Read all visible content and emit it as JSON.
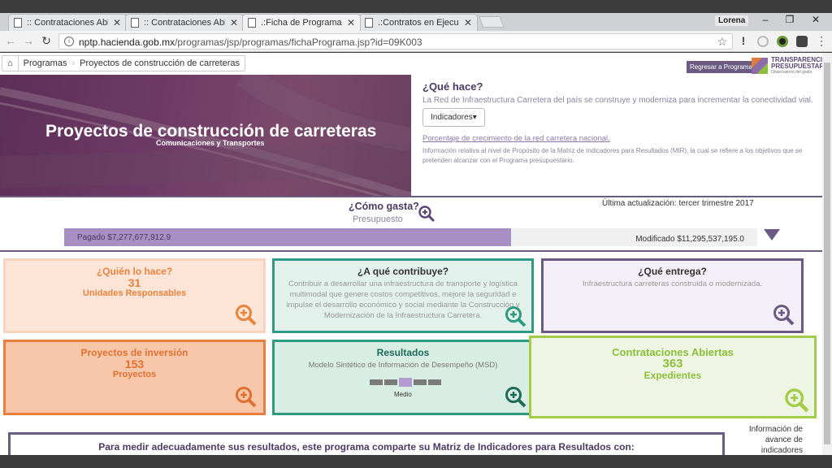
{
  "browser": {
    "tabs": [
      {
        "title": ":: Contrataciones Abiert"
      },
      {
        "title": ":: Contrataciones Abiert"
      },
      {
        "title": ".:Ficha de Programa"
      },
      {
        "title": ".:Contratos en Ejecución:."
      }
    ],
    "active_tab": 2,
    "user": "Lorena",
    "url_host": "nptp.hacienda.gob.mx",
    "url_path": "/programas/jsp/programas/fichaPrograma.jsp?id=09K003"
  },
  "breadcrumb": {
    "items": [
      "Programas",
      "Proyectos de construcción de carreteras"
    ]
  },
  "header_links": {
    "back": "Regresar a Programas",
    "logo_line1": "TRANSPARENCIA",
    "logo_line2": "PRESUPUESTARIA",
    "logo_tag": "Observatorio del gasto"
  },
  "hero": {
    "title": "Proyectos de construcción de carreteras",
    "subtitle": "Comunicaciones y Transportes"
  },
  "que_hace": {
    "heading": "¿Qué hace?",
    "description": "La Red de Infraestructura Carretera del país se construye y moderniza para incrementar la conectividad vial.",
    "button": "Indicadores",
    "link": "Porcentaje de crecimiento de la red carretera nacional.",
    "note": "Información relativa al nivel de Propósito de la Matriz de Indicadores para Resultados (MIR), la cual se refiere a los objetivos que se pretenden alcanzar con el Programa presupuestario."
  },
  "gasto": {
    "heading": "¿Cómo gasta?",
    "sub": "Presupuesto",
    "updated": "Última actualización: tercer trimestre 2017",
    "paid_label": "Pagado $7,277,677,912.9",
    "modified_label": "Modificado $11,295,537,195.0",
    "paid": 7277677912.9,
    "modified": 11295537195.0
  },
  "cards": {
    "quien": {
      "title": "¿Quién lo hace?",
      "number": "31",
      "label": "Unidades Responsables"
    },
    "contribuye": {
      "title": "¿A qué contribuye?",
      "text": "Contribuir a desarrollar una infraestructura de transporte y logística multimodal que genere costos competitivos, mejore la seguridad e impulse el desarrollo económico y social mediante la Construcción y Modernización de la Infraestructura Carretera."
    },
    "entrega": {
      "title": "¿Qué entrega?",
      "text": "Infraestructura carreteras construida o modernizada."
    },
    "proyectos": {
      "title": "Proyectos de inversión",
      "number": "153",
      "label": "Proyectos"
    },
    "resultados": {
      "title": "Resultados",
      "text": "Modelo Sintético de Información de Desempeño (MSD)",
      "level": "Medio",
      "segments": 5,
      "active_segment": 3
    },
    "contrataciones": {
      "title": "Contrataciones Abiertas",
      "number": "363",
      "label": "Expedientes"
    }
  },
  "avance": "Información de avance de indicadores",
  "bottom_panel": "Para medir adecuadamente sus resultados, este programa comparte su Matriz de Indicadores para Resultados con:"
}
